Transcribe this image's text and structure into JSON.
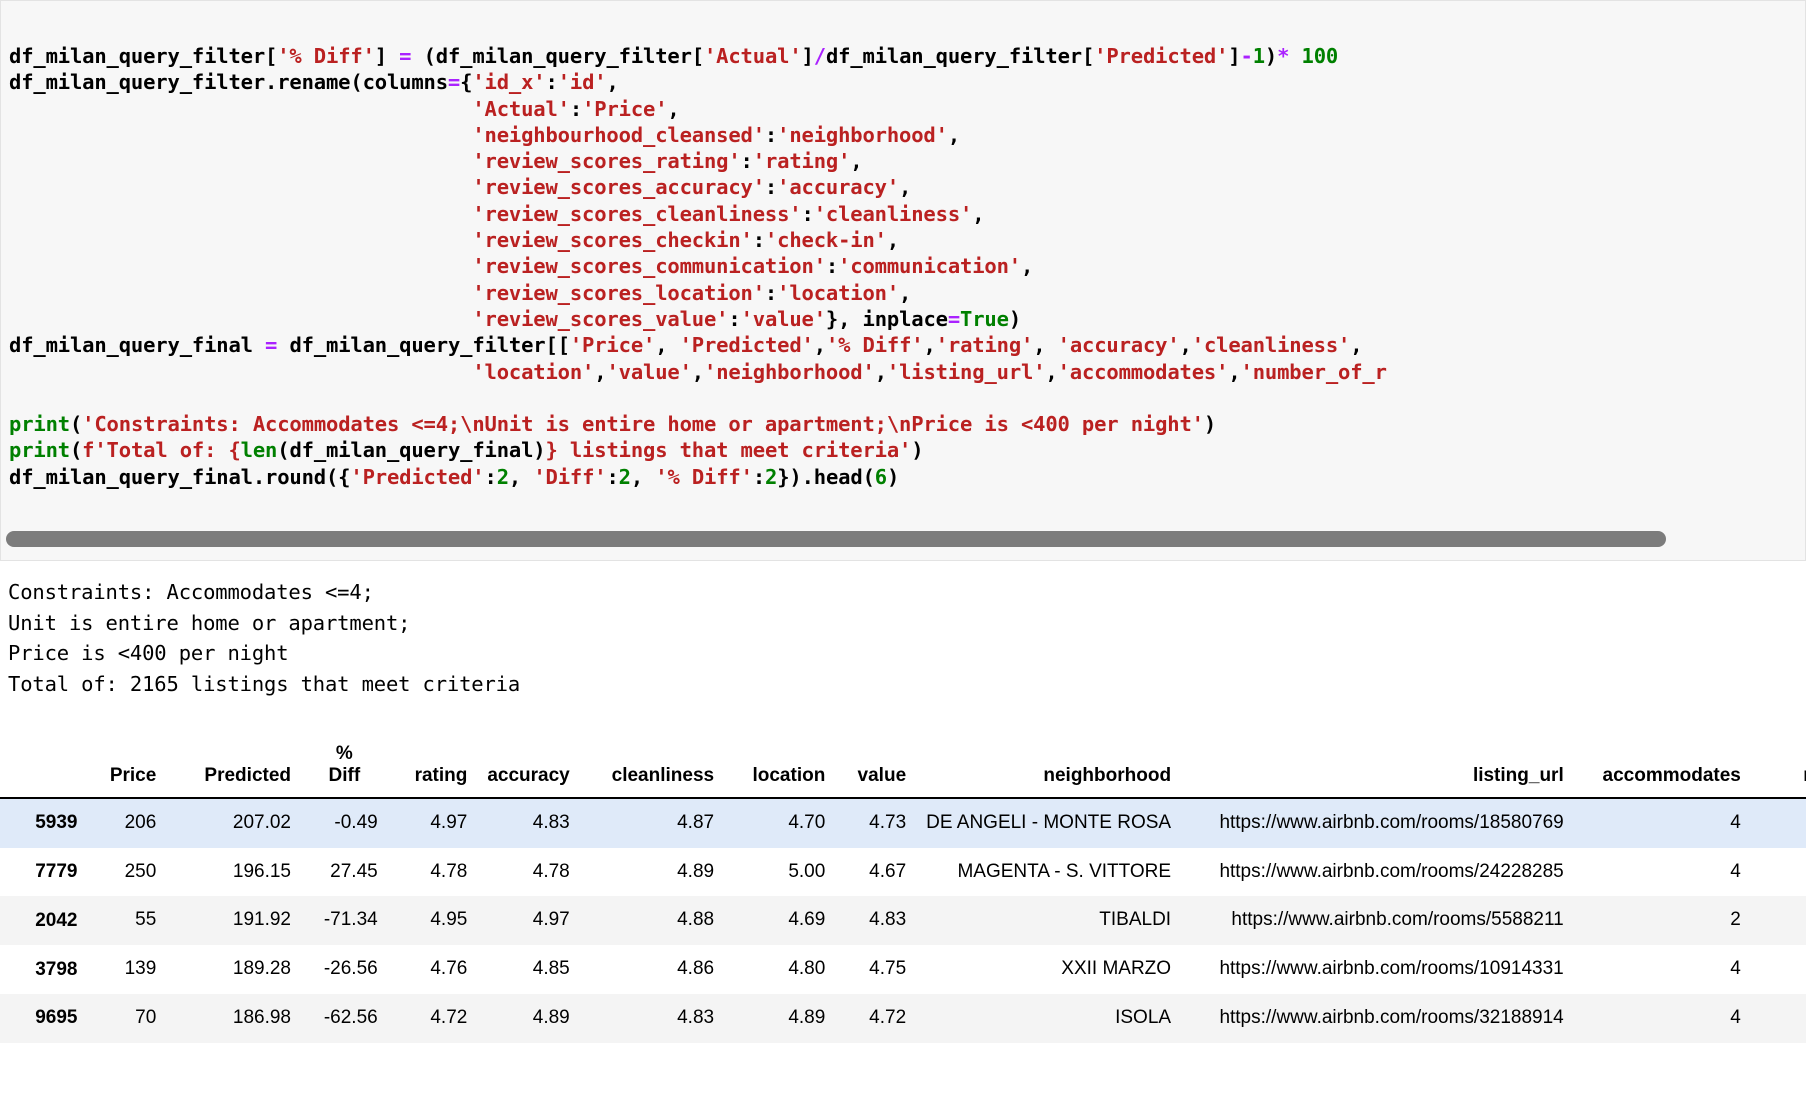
{
  "code_cell": {
    "language": "python",
    "lines": [
      [
        {
          "t": "df_milan_query_filter[",
          "c": "p"
        },
        {
          "t": "'% Diff'",
          "c": "s"
        },
        {
          "t": "] ",
          "c": "p"
        },
        {
          "t": "=",
          "c": "o"
        },
        {
          "t": " (df_milan_query_filter[",
          "c": "p"
        },
        {
          "t": "'Actual'",
          "c": "s"
        },
        {
          "t": "]",
          "c": "p"
        },
        {
          "t": "/",
          "c": "o"
        },
        {
          "t": "df_milan_query_filter[",
          "c": "p"
        },
        {
          "t": "'Predicted'",
          "c": "s"
        },
        {
          "t": "]",
          "c": "p"
        },
        {
          "t": "-",
          "c": "o"
        },
        {
          "t": "1",
          "c": "n"
        },
        {
          "t": ")",
          "c": "p"
        },
        {
          "t": "*",
          "c": "o"
        },
        {
          "t": " ",
          "c": "p"
        },
        {
          "t": "100",
          "c": "n"
        }
      ],
      [
        {
          "t": "df_milan_query_filter.rename(columns",
          "c": "p"
        },
        {
          "t": "=",
          "c": "o"
        },
        {
          "t": "{",
          "c": "p"
        },
        {
          "t": "'id_x'",
          "c": "s"
        },
        {
          "t": ":",
          "c": "p"
        },
        {
          "t": "'id'",
          "c": "s"
        },
        {
          "t": ",",
          "c": "p"
        }
      ],
      [
        {
          "t": "                                      ",
          "c": "p"
        },
        {
          "t": "'Actual'",
          "c": "s"
        },
        {
          "t": ":",
          "c": "p"
        },
        {
          "t": "'Price'",
          "c": "s"
        },
        {
          "t": ",",
          "c": "p"
        }
      ],
      [
        {
          "t": "                                      ",
          "c": "p"
        },
        {
          "t": "'neighbourhood_cleansed'",
          "c": "s"
        },
        {
          "t": ":",
          "c": "p"
        },
        {
          "t": "'neighborhood'",
          "c": "s"
        },
        {
          "t": ",",
          "c": "p"
        }
      ],
      [
        {
          "t": "                                      ",
          "c": "p"
        },
        {
          "t": "'review_scores_rating'",
          "c": "s"
        },
        {
          "t": ":",
          "c": "p"
        },
        {
          "t": "'rating'",
          "c": "s"
        },
        {
          "t": ",",
          "c": "p"
        }
      ],
      [
        {
          "t": "                                      ",
          "c": "p"
        },
        {
          "t": "'review_scores_accuracy'",
          "c": "s"
        },
        {
          "t": ":",
          "c": "p"
        },
        {
          "t": "'accuracy'",
          "c": "s"
        },
        {
          "t": ",",
          "c": "p"
        }
      ],
      [
        {
          "t": "                                      ",
          "c": "p"
        },
        {
          "t": "'review_scores_cleanliness'",
          "c": "s"
        },
        {
          "t": ":",
          "c": "p"
        },
        {
          "t": "'cleanliness'",
          "c": "s"
        },
        {
          "t": ",",
          "c": "p"
        }
      ],
      [
        {
          "t": "                                      ",
          "c": "p"
        },
        {
          "t": "'review_scores_checkin'",
          "c": "s"
        },
        {
          "t": ":",
          "c": "p"
        },
        {
          "t": "'check-in'",
          "c": "s"
        },
        {
          "t": ",",
          "c": "p"
        }
      ],
      [
        {
          "t": "                                      ",
          "c": "p"
        },
        {
          "t": "'review_scores_communication'",
          "c": "s"
        },
        {
          "t": ":",
          "c": "p"
        },
        {
          "t": "'communication'",
          "c": "s"
        },
        {
          "t": ",",
          "c": "p"
        }
      ],
      [
        {
          "t": "                                      ",
          "c": "p"
        },
        {
          "t": "'review_scores_location'",
          "c": "s"
        },
        {
          "t": ":",
          "c": "p"
        },
        {
          "t": "'location'",
          "c": "s"
        },
        {
          "t": ",",
          "c": "p"
        }
      ],
      [
        {
          "t": "                                      ",
          "c": "p"
        },
        {
          "t": "'review_scores_value'",
          "c": "s"
        },
        {
          "t": ":",
          "c": "p"
        },
        {
          "t": "'value'",
          "c": "s"
        },
        {
          "t": "}, inplace",
          "c": "p"
        },
        {
          "t": "=",
          "c": "o"
        },
        {
          "t": "True",
          "c": "k"
        },
        {
          "t": ")",
          "c": "p"
        }
      ],
      [
        {
          "t": "df_milan_query_final ",
          "c": "p"
        },
        {
          "t": "=",
          "c": "o"
        },
        {
          "t": " df_milan_query_filter[[",
          "c": "p"
        },
        {
          "t": "'Price'",
          "c": "s"
        },
        {
          "t": ", ",
          "c": "p"
        },
        {
          "t": "'Predicted'",
          "c": "s"
        },
        {
          "t": ",",
          "c": "p"
        },
        {
          "t": "'% Diff'",
          "c": "s"
        },
        {
          "t": ",",
          "c": "p"
        },
        {
          "t": "'rating'",
          "c": "s"
        },
        {
          "t": ", ",
          "c": "p"
        },
        {
          "t": "'accuracy'",
          "c": "s"
        },
        {
          "t": ",",
          "c": "p"
        },
        {
          "t": "'cleanliness'",
          "c": "s"
        },
        {
          "t": ",",
          "c": "p"
        }
      ],
      [
        {
          "t": "                                      ",
          "c": "p"
        },
        {
          "t": "'location'",
          "c": "s"
        },
        {
          "t": ",",
          "c": "p"
        },
        {
          "t": "'value'",
          "c": "s"
        },
        {
          "t": ",",
          "c": "p"
        },
        {
          "t": "'neighborhood'",
          "c": "s"
        },
        {
          "t": ",",
          "c": "p"
        },
        {
          "t": "'listing_url'",
          "c": "s"
        },
        {
          "t": ",",
          "c": "p"
        },
        {
          "t": "'accommodates'",
          "c": "s"
        },
        {
          "t": ",",
          "c": "p"
        },
        {
          "t": "'number_of_r",
          "c": "s"
        }
      ],
      [
        {
          "t": "",
          "c": "p"
        }
      ],
      [
        {
          "t": "print",
          "c": "bi"
        },
        {
          "t": "(",
          "c": "p"
        },
        {
          "t": "'Constraints: Accommodates <=4;\\nUnit is entire home or apartment;\\nPrice is <400 per night'",
          "c": "s"
        },
        {
          "t": ")",
          "c": "p"
        }
      ],
      [
        {
          "t": "print",
          "c": "bi"
        },
        {
          "t": "(",
          "c": "p"
        },
        {
          "t": "f'Total of: {",
          "c": "s"
        },
        {
          "t": "len",
          "c": "bi"
        },
        {
          "t": "(df_milan_query_final)",
          "c": "p"
        },
        {
          "t": "} listings that meet criteria'",
          "c": "s"
        },
        {
          "t": ")",
          "c": "p"
        }
      ],
      [
        {
          "t": "df_milan_query_final.round({",
          "c": "p"
        },
        {
          "t": "'Predicted'",
          "c": "s"
        },
        {
          "t": ":",
          "c": "p"
        },
        {
          "t": "2",
          "c": "n"
        },
        {
          "t": ", ",
          "c": "p"
        },
        {
          "t": "'Diff'",
          "c": "s"
        },
        {
          "t": ":",
          "c": "p"
        },
        {
          "t": "2",
          "c": "n"
        },
        {
          "t": ", ",
          "c": "p"
        },
        {
          "t": "'% Diff'",
          "c": "s"
        },
        {
          "t": ":",
          "c": "p"
        },
        {
          "t": "2",
          "c": "n"
        },
        {
          "t": "}).head(",
          "c": "p"
        },
        {
          "t": "6",
          "c": "n"
        },
        {
          "t": ")",
          "c": "p"
        }
      ]
    ],
    "scrollbar": {
      "name": "horizontal-scrollbar"
    }
  },
  "stdout": {
    "lines": [
      "Constraints: Accommodates <=4;",
      "Unit is entire home or apartment;",
      "Price is <400 per night",
      "Total of: 2165 listings that meet criteria"
    ],
    "text": "Constraints: Accommodates <=4;\nUnit is entire home or apartment;\nPrice is <400 per night\nTotal of: 2165 listings that meet criteria"
  },
  "dataframe": {
    "index_header": "",
    "columns": [
      "Price",
      "Predicted",
      "% Diff",
      "rating",
      "accuracy",
      "cleanliness",
      "location",
      "value",
      "neighborhood",
      "listing_url",
      "accommodates",
      "number_of_re"
    ],
    "pct_diff_header_line1": "%",
    "pct_diff_header_line2": "Diff",
    "rows": [
      {
        "index": "5939",
        "price": "206",
        "predicted": "207.02",
        "pct_diff": "-0.49",
        "rating": "4.97",
        "accuracy": "4.83",
        "cleanliness": "4.87",
        "location": "4.70",
        "value": "4.73",
        "neighborhood": "DE ANGELI - MONTE ROSA",
        "listing_url": "https://www.airbnb.com/rooms/18580769",
        "accommodates": "4",
        "number_of_reviews": ""
      },
      {
        "index": "7779",
        "price": "250",
        "predicted": "196.15",
        "pct_diff": "27.45",
        "rating": "4.78",
        "accuracy": "4.78",
        "cleanliness": "4.89",
        "location": "5.00",
        "value": "4.67",
        "neighborhood": "MAGENTA - S. VITTORE",
        "listing_url": "https://www.airbnb.com/rooms/24228285",
        "accommodates": "4",
        "number_of_reviews": ""
      },
      {
        "index": "2042",
        "price": "55",
        "predicted": "191.92",
        "pct_diff": "-71.34",
        "rating": "4.95",
        "accuracy": "4.97",
        "cleanliness": "4.88",
        "location": "4.69",
        "value": "4.83",
        "neighborhood": "TIBALDI",
        "listing_url": "https://www.airbnb.com/rooms/5588211",
        "accommodates": "2",
        "number_of_reviews": ""
      },
      {
        "index": "3798",
        "price": "139",
        "predicted": "189.28",
        "pct_diff": "-26.56",
        "rating": "4.76",
        "accuracy": "4.85",
        "cleanliness": "4.86",
        "location": "4.80",
        "value": "4.75",
        "neighborhood": "XXII MARZO",
        "listing_url": "https://www.airbnb.com/rooms/10914331",
        "accommodates": "4",
        "number_of_reviews": ""
      },
      {
        "index": "9695",
        "price": "70",
        "predicted": "186.98",
        "pct_diff": "-62.56",
        "rating": "4.72",
        "accuracy": "4.89",
        "cleanliness": "4.83",
        "location": "4.89",
        "value": "4.72",
        "neighborhood": "ISOLA",
        "listing_url": "https://www.airbnb.com/rooms/32188914",
        "accommodates": "4",
        "number_of_reviews": ""
      }
    ]
  },
  "colors": {
    "code_background": "#f7f7f7",
    "string_literal": "#ba2121",
    "operator": "#aa22ff",
    "number_keyword": "#008000",
    "highlight_row": "#dfeaf9",
    "alt_row": "#f4f4f4",
    "scrollbar_thumb": "#7c7c7c"
  }
}
